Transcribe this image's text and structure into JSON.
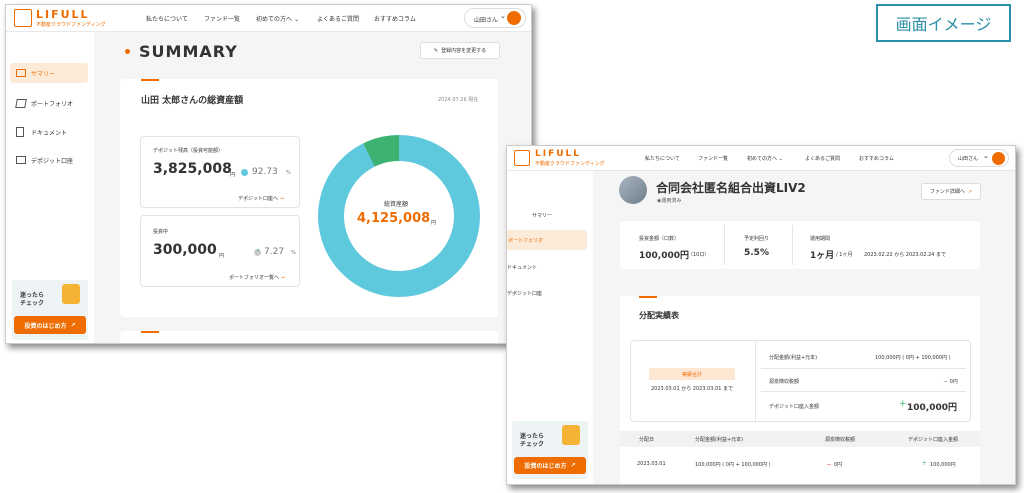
{
  "label": "画面イメージ",
  "logo": {
    "name": "LIFULL",
    "sub": "不動産クラウドファンディング"
  },
  "nav": [
    "私たちについて",
    "ファンド一覧",
    "初めての方へ",
    "よくあるご質問",
    "おすすめコラム"
  ],
  "user": "山田さん",
  "sidebar": [
    "サマリー",
    "ポートフォリオ",
    "ドキュメント",
    "デポジット口座"
  ],
  "promo": {
    "line1": "迷ったら",
    "line2": "チェック",
    "button": "投資のはじめ方"
  },
  "summary": {
    "heading": "SUMMARY",
    "change_btn": "登録内容を変更する",
    "total_title": "山田 太郎さんの総資産額",
    "date": "2024.07.26 現在",
    "deposit_label": "デポジット残高（投資可能額）",
    "deposit_value": "3,825,008",
    "deposit_unit": "円",
    "deposit_pct": "92.73",
    "deposit_link": "デポジット口座へ",
    "invest_label": "投資中",
    "invest_value": "300,000",
    "invest_unit": "円",
    "invest_pct": "7.27",
    "invest_link": "ポートフォリオ一覧へ",
    "donut_label": "総資産額",
    "donut_value": "4,125,008",
    "donut_unit": "円",
    "pct_sign": "%"
  },
  "colors": {
    "deposit": "#5ec8dd",
    "invest": "#3cb371",
    "accent": "#ef6c00"
  },
  "detail": {
    "fund_title": "合同会社匿名組合出資LIV2",
    "status": "運用済み",
    "fund_btn": "ファンド詳細へ",
    "inv_label": "投資金額（口数）",
    "inv_value": "100,000円",
    "inv_units": "（10口）",
    "yield_label": "予定利回り",
    "yield_value": "5.5%",
    "period_label": "運用期間",
    "period_value": "1ヶ月",
    "period_unit": "/ 1ヶ月",
    "period_range": "2023.02.22 から 2023.02.24 まで",
    "dist_title": "分配実績表",
    "results_badge": "実績合計",
    "results_range": "2023.03.01 から 2023.03.01 まで",
    "row1_label": "分配金額(利益+元本)",
    "row1_value": "100,000円 ( 0円 + 100,000円 )",
    "row2_label": "源泉徴収税額",
    "row2_value": "－ 0円",
    "row3_label": "デポジット口座入金額",
    "row3_value": "100,000円",
    "row3_plus": "+",
    "table_headers": [
      "分配日",
      "分配金額(利益+元本)",
      "源泉徴収税額",
      "デポジット口座入金額"
    ],
    "table_row": [
      "2023.03.01",
      "100,000円 ( 0円 + 100,000円 )",
      "0円",
      "100,000円"
    ],
    "minus": "－",
    "plus": "+"
  }
}
